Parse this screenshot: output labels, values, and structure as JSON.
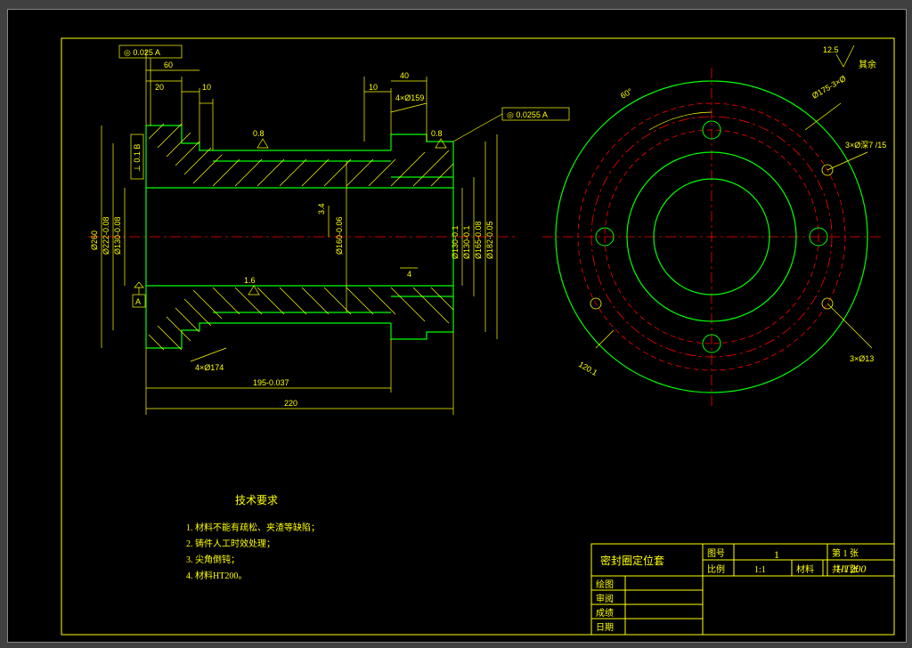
{
  "drawing": {
    "frame_tolerance_left": "◎ 0.025 A",
    "frame_tolerance_right": "◎ 0.0255 A",
    "datum_A": "A",
    "datum_B": "B",
    "perp_tol": "⊥ 0.1 B",
    "dims_top": {
      "d60": "60",
      "d20": "20",
      "d10a": "10",
      "d10b": "10",
      "d40": "40",
      "holes_left": "4×Ø159",
      "holes_note_left": "4×Ø174",
      "sf_08a": "0.8",
      "sf_08b": "0.8",
      "sf_16": "1.6",
      "d4": "4",
      "d34": "3.4"
    },
    "dims_vert": {
      "d260": "Ø260",
      "d222": "Ø222-0.08",
      "d130": "Ø130-0.08",
      "d160": "Ø160-0.06",
      "d130b": "Ø130-0.1",
      "d165": "Ø165-0.08",
      "d182": "Ø182-0.05"
    },
    "dims_bot": {
      "d195": "195-0.037",
      "d220": "220"
    },
    "right_view": {
      "angle60": "60°",
      "sf_125": "12.5",
      "rest_label": "其余",
      "d175": "Ø175-3×Ø",
      "note3a": "3×Ø深7\n/15",
      "note3b": "3×Ø13",
      "r124": "120.1"
    }
  },
  "tech_req": {
    "title": "技术要求",
    "items": [
      "1. 材料不能有疏松、夹渣等缺陷；",
      "2. 铸件人工时效处理；",
      "3. 尖角倒钝；",
      "4. 材料HT200。"
    ]
  },
  "title_block": {
    "part_name": "密封圈定位套",
    "col_sheet_no": "图号",
    "sheet_no": "1",
    "page_current": "第 1 张",
    "page_total": "共 1 张",
    "col_scale": "比例",
    "scale": "1:1",
    "col_material": "材料",
    "material": "HT200",
    "rows": [
      "绘图",
      "审阅",
      "成绩",
      "日期"
    ]
  }
}
